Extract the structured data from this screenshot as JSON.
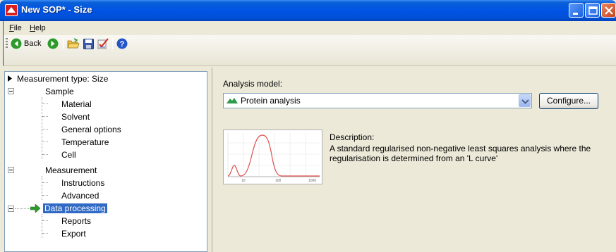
{
  "window": {
    "title": "New SOP* - Size",
    "accent_color": "#0054e3",
    "close_color": "#c9441c"
  },
  "menu": {
    "items": [
      {
        "label": "File",
        "mnemonic": "F"
      },
      {
        "label": "Help",
        "mnemonic": "H"
      }
    ]
  },
  "toolbar": {
    "back_label": "Back",
    "icons": [
      "back-arrow-icon",
      "forward-arrow-icon",
      "open-folder-icon",
      "save-disk-icon",
      "edit-check-icon",
      "help-icon"
    ]
  },
  "tree": {
    "root_label": "Measurement type: Size",
    "sample": {
      "label": "Sample",
      "children": [
        "Material",
        "Solvent",
        "General options",
        "Temperature",
        "Cell"
      ]
    },
    "measurement": {
      "label": "Measurement",
      "children": [
        "Instructions",
        "Advanced"
      ]
    },
    "data_processing": {
      "label": "Data processing",
      "children": [
        "Reports",
        "Export"
      ]
    }
  },
  "analysis": {
    "model_label": "Analysis model:",
    "selected_model": "Protein analysis",
    "configure_label": "Configure...",
    "description_label": "Description:",
    "description_text": "A standard regularised non-negative least squares analysis where the regularisation is determined from an 'L curve'",
    "thumbnail_ticks": [
      "10",
      "100",
      "1000"
    ]
  }
}
